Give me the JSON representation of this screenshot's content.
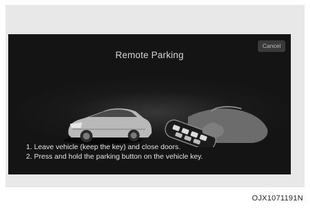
{
  "screen": {
    "title": "Remote Parking",
    "cancel_label": "Cancel",
    "instructions": [
      "1. Leave vehicle (keep the key) and close doors.",
      "2. Press and hold the parking button on the vehicle key."
    ]
  },
  "figure_code": "OJX1071191N",
  "colors": {
    "screen_background": "#141414",
    "frame_background": "#e8e8e8",
    "text": "#e4e4e4"
  },
  "icons": [
    "car-illustration",
    "hand-holding-key-icon"
  ]
}
